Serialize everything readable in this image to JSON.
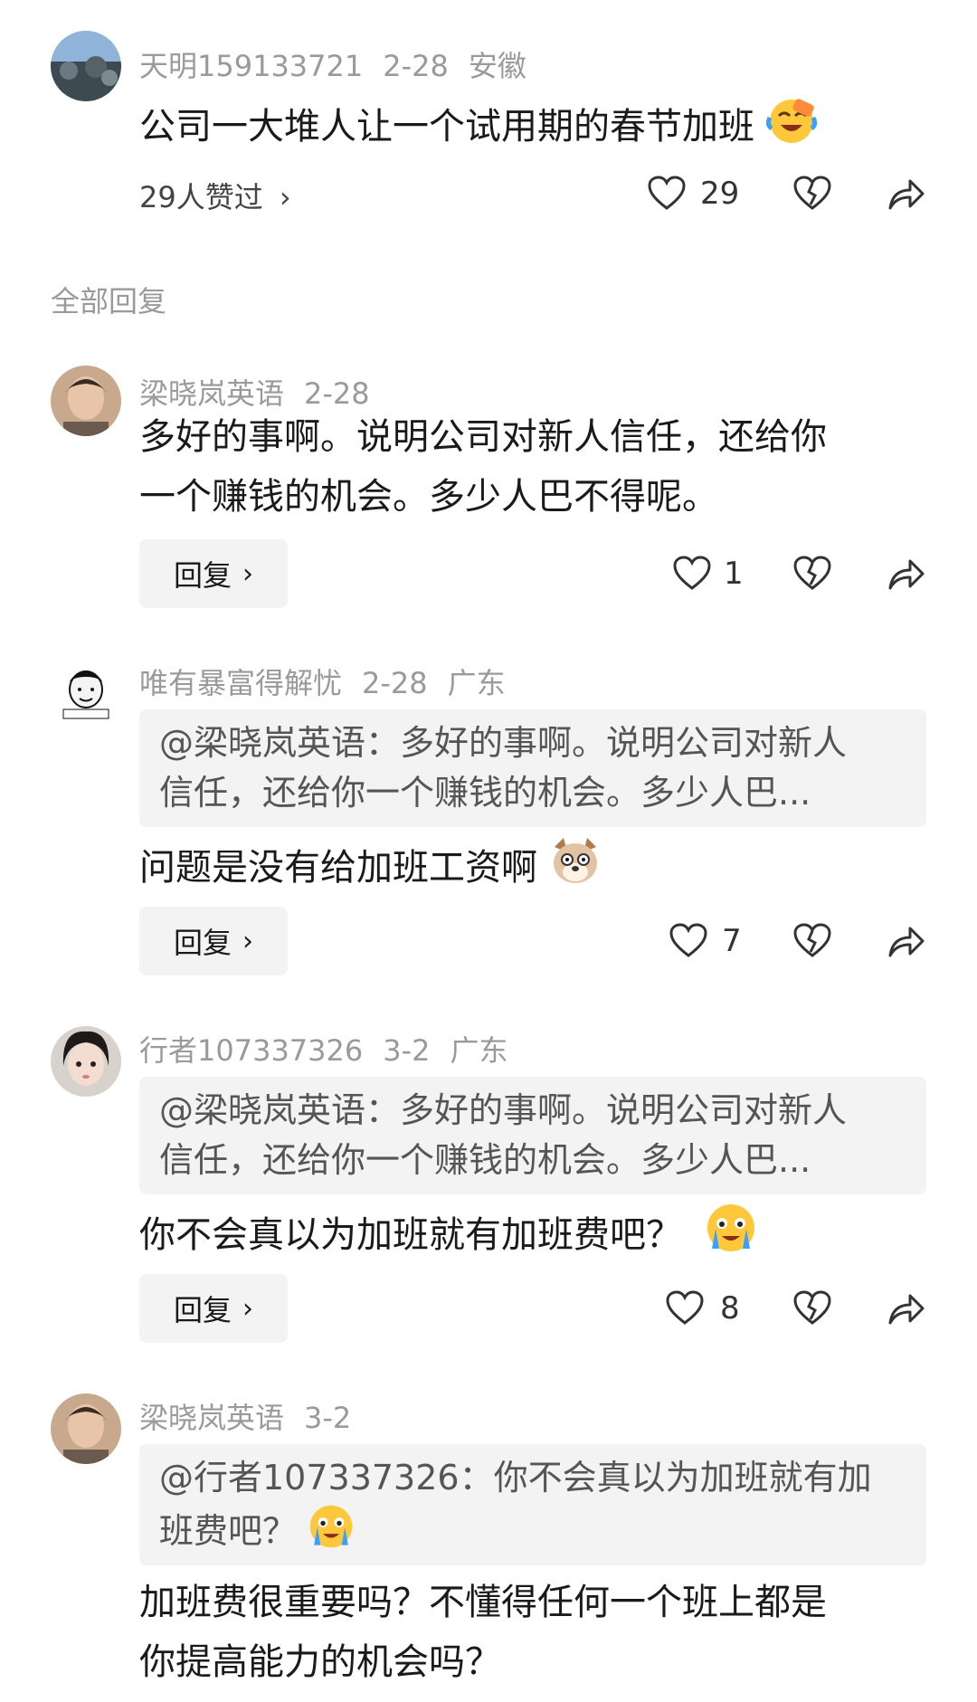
{
  "top_comment": {
    "user": "天明159133721",
    "date": "2-28",
    "location": "安徽",
    "text": "公司一大堆人让一个试用期的春节加班",
    "likes_summary": "29人赞过",
    "like_count": "29",
    "emoji": "laughing-crying-emoji"
  },
  "section_title": "全部回复",
  "replies": [
    {
      "user": "梁晓岚英语",
      "date": "2-28",
      "text": "多好的事啊。说明公司对新人信任，还给你一个赚钱的机会。多少人巴不得呢。",
      "text_line1": "多好的事啊。说明公司对新人信任，还给你",
      "text_line2": "一个赚钱的机会。多少人巴不得呢。",
      "like_count": "1",
      "reply_label": "回复"
    },
    {
      "user": "唯有暴富得解忧",
      "date": "2-28",
      "location": "广东",
      "quote_line1": "@梁晓岚英语：多好的事啊。说明公司对新人",
      "quote_line2": "信任，还给你一个赚钱的机会。多少人巴...",
      "text": "问题是没有给加班工资啊",
      "emoji": "dog-face-emoji",
      "like_count": "7",
      "reply_label": "回复"
    },
    {
      "user": "行者107337326",
      "date": "3-2",
      "location": "广东",
      "quote_line1": "@梁晓岚英语：多好的事啊。说明公司对新人",
      "quote_line2": "信任，还给你一个赚钱的机会。多少人巴...",
      "text": "你不会真以为加班就有加班费吧？",
      "emoji": "crying-emoji",
      "like_count": "8",
      "reply_label": "回复"
    },
    {
      "user": "梁晓岚英语",
      "date": "3-2",
      "quote_line1": "@行者107337326：你不会真以为加班就有加",
      "quote_line2": "班费吧？",
      "quote_emoji": "crying-emoji",
      "text_line1": "加班费很重要吗？不懂得任何一个班上都是",
      "text_line2": "你提高能力的机会吗？"
    }
  ],
  "colors": {
    "meta": "#9a9a9a",
    "text": "#1a1a1a",
    "quote_bg": "#f3f3f3",
    "icon": "#333333"
  }
}
